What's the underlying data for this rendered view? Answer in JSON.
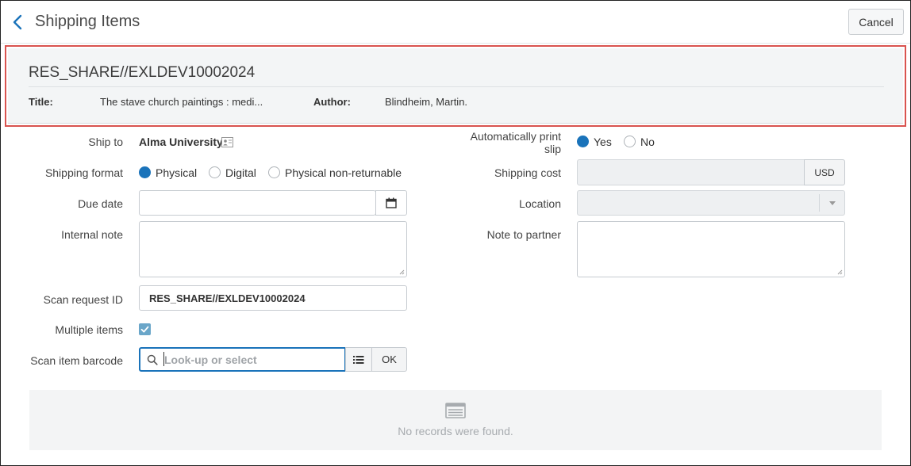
{
  "header": {
    "title": "Shipping Items",
    "cancel_label": "Cancel"
  },
  "summary": {
    "request_id": "RES_SHARE//EXLDEV10002024",
    "title_label": "Title:",
    "title_value": "The stave church paintings : medi...",
    "author_label": "Author:",
    "author_value": "Blindheim, Martin."
  },
  "form": {
    "ship_to": {
      "label": "Ship to",
      "value": "Alma University"
    },
    "shipping_format": {
      "label": "Shipping format",
      "options": [
        "Physical",
        "Digital",
        "Physical non-returnable"
      ],
      "selected": "Physical"
    },
    "due_date": {
      "label": "Due date",
      "value": ""
    },
    "internal_note": {
      "label": "Internal note",
      "value": ""
    },
    "scan_request_id": {
      "label": "Scan request ID",
      "value": "RES_SHARE//EXLDEV10002024"
    },
    "multiple_items": {
      "label": "Multiple items",
      "checked": true
    },
    "scan_item_barcode": {
      "label": "Scan item barcode",
      "placeholder": "Look-up or select",
      "ok_label": "OK"
    },
    "auto_print_slip": {
      "label_line1": "Automatically print",
      "label_line2": "slip",
      "options": [
        "Yes",
        "No"
      ],
      "selected": "Yes"
    },
    "shipping_cost": {
      "label": "Shipping cost",
      "currency": "USD",
      "value": ""
    },
    "location": {
      "label": "Location",
      "value": ""
    },
    "note_to_partner": {
      "label": "Note to partner",
      "value": ""
    }
  },
  "records": {
    "empty_text": "No records were found."
  },
  "colors": {
    "accent": "#1a73ba",
    "highlight_border": "#d9534f",
    "checkbox": "#6aa6c9"
  }
}
